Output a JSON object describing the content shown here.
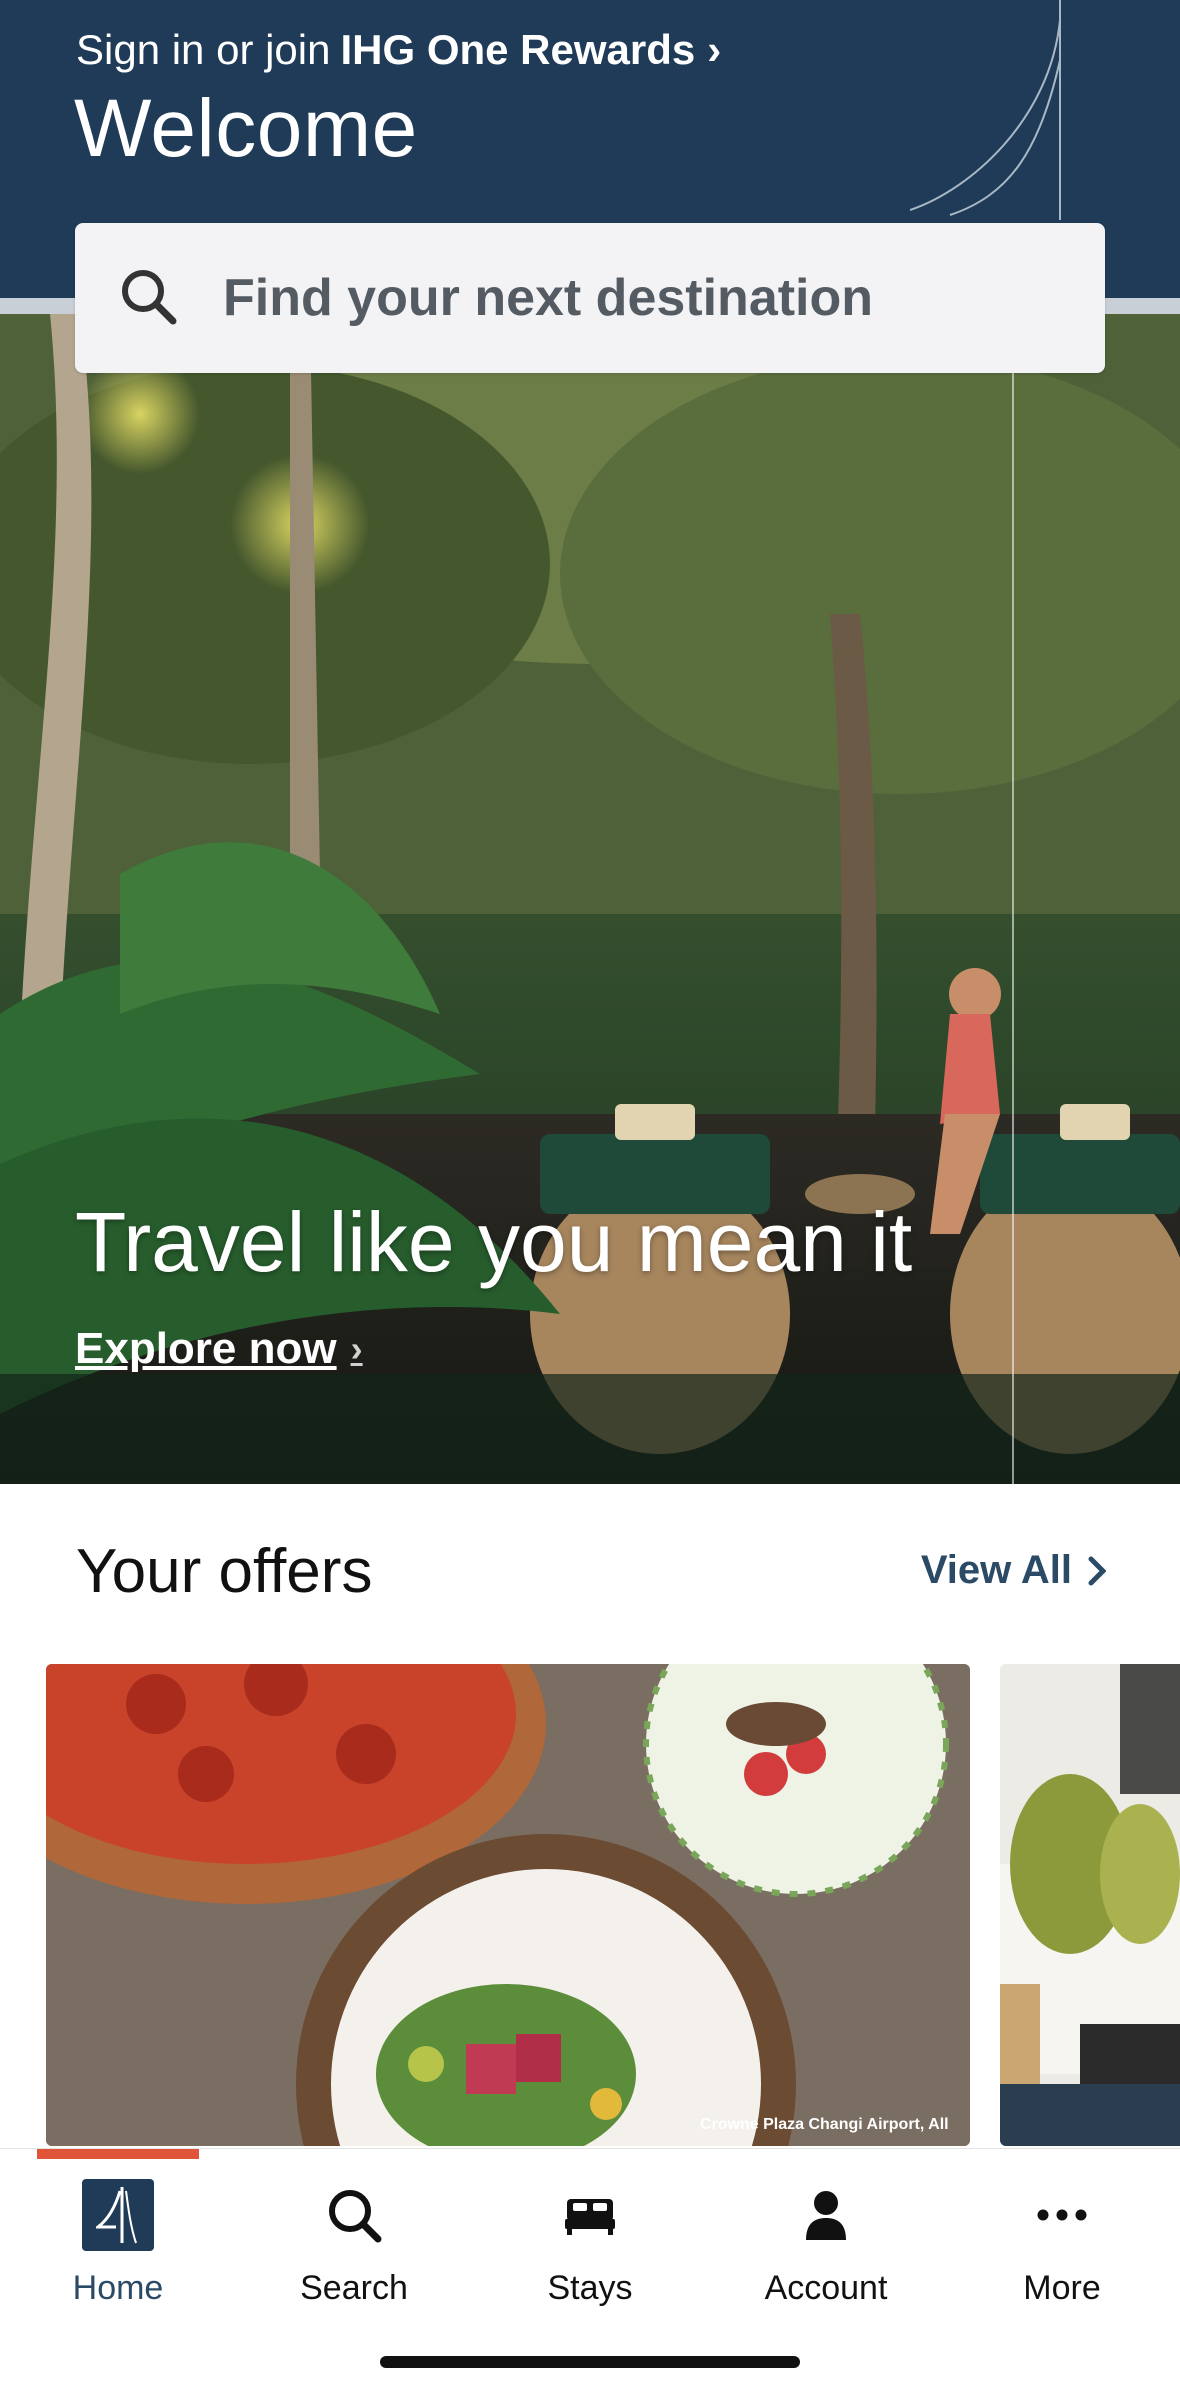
{
  "header": {
    "signin_prefix": "Sign in or join",
    "signin_brand": "IHG One Rewards",
    "welcome": "Welcome",
    "colors": {
      "navy": "#1f3b57"
    }
  },
  "search": {
    "placeholder": "Find your next destination",
    "icon": "search-icon"
  },
  "hero": {
    "title": "Travel like you mean it",
    "link_label": "Explore now"
  },
  "offers": {
    "title": "Your offers",
    "view_all": "View All",
    "cards": [
      {
        "credit": "Crowne Plaza Changi Airport, All"
      },
      {
        "credit": ""
      }
    ]
  },
  "tabbar": {
    "accent": "#e0543a",
    "tabs": [
      {
        "label": "Home",
        "icon": "ihg-logo-icon",
        "active": true
      },
      {
        "label": "Search",
        "icon": "search-icon",
        "active": false
      },
      {
        "label": "Stays",
        "icon": "bed-icon",
        "active": false
      },
      {
        "label": "Account",
        "icon": "person-icon",
        "active": false
      },
      {
        "label": "More",
        "icon": "more-icon",
        "active": false
      }
    ]
  }
}
